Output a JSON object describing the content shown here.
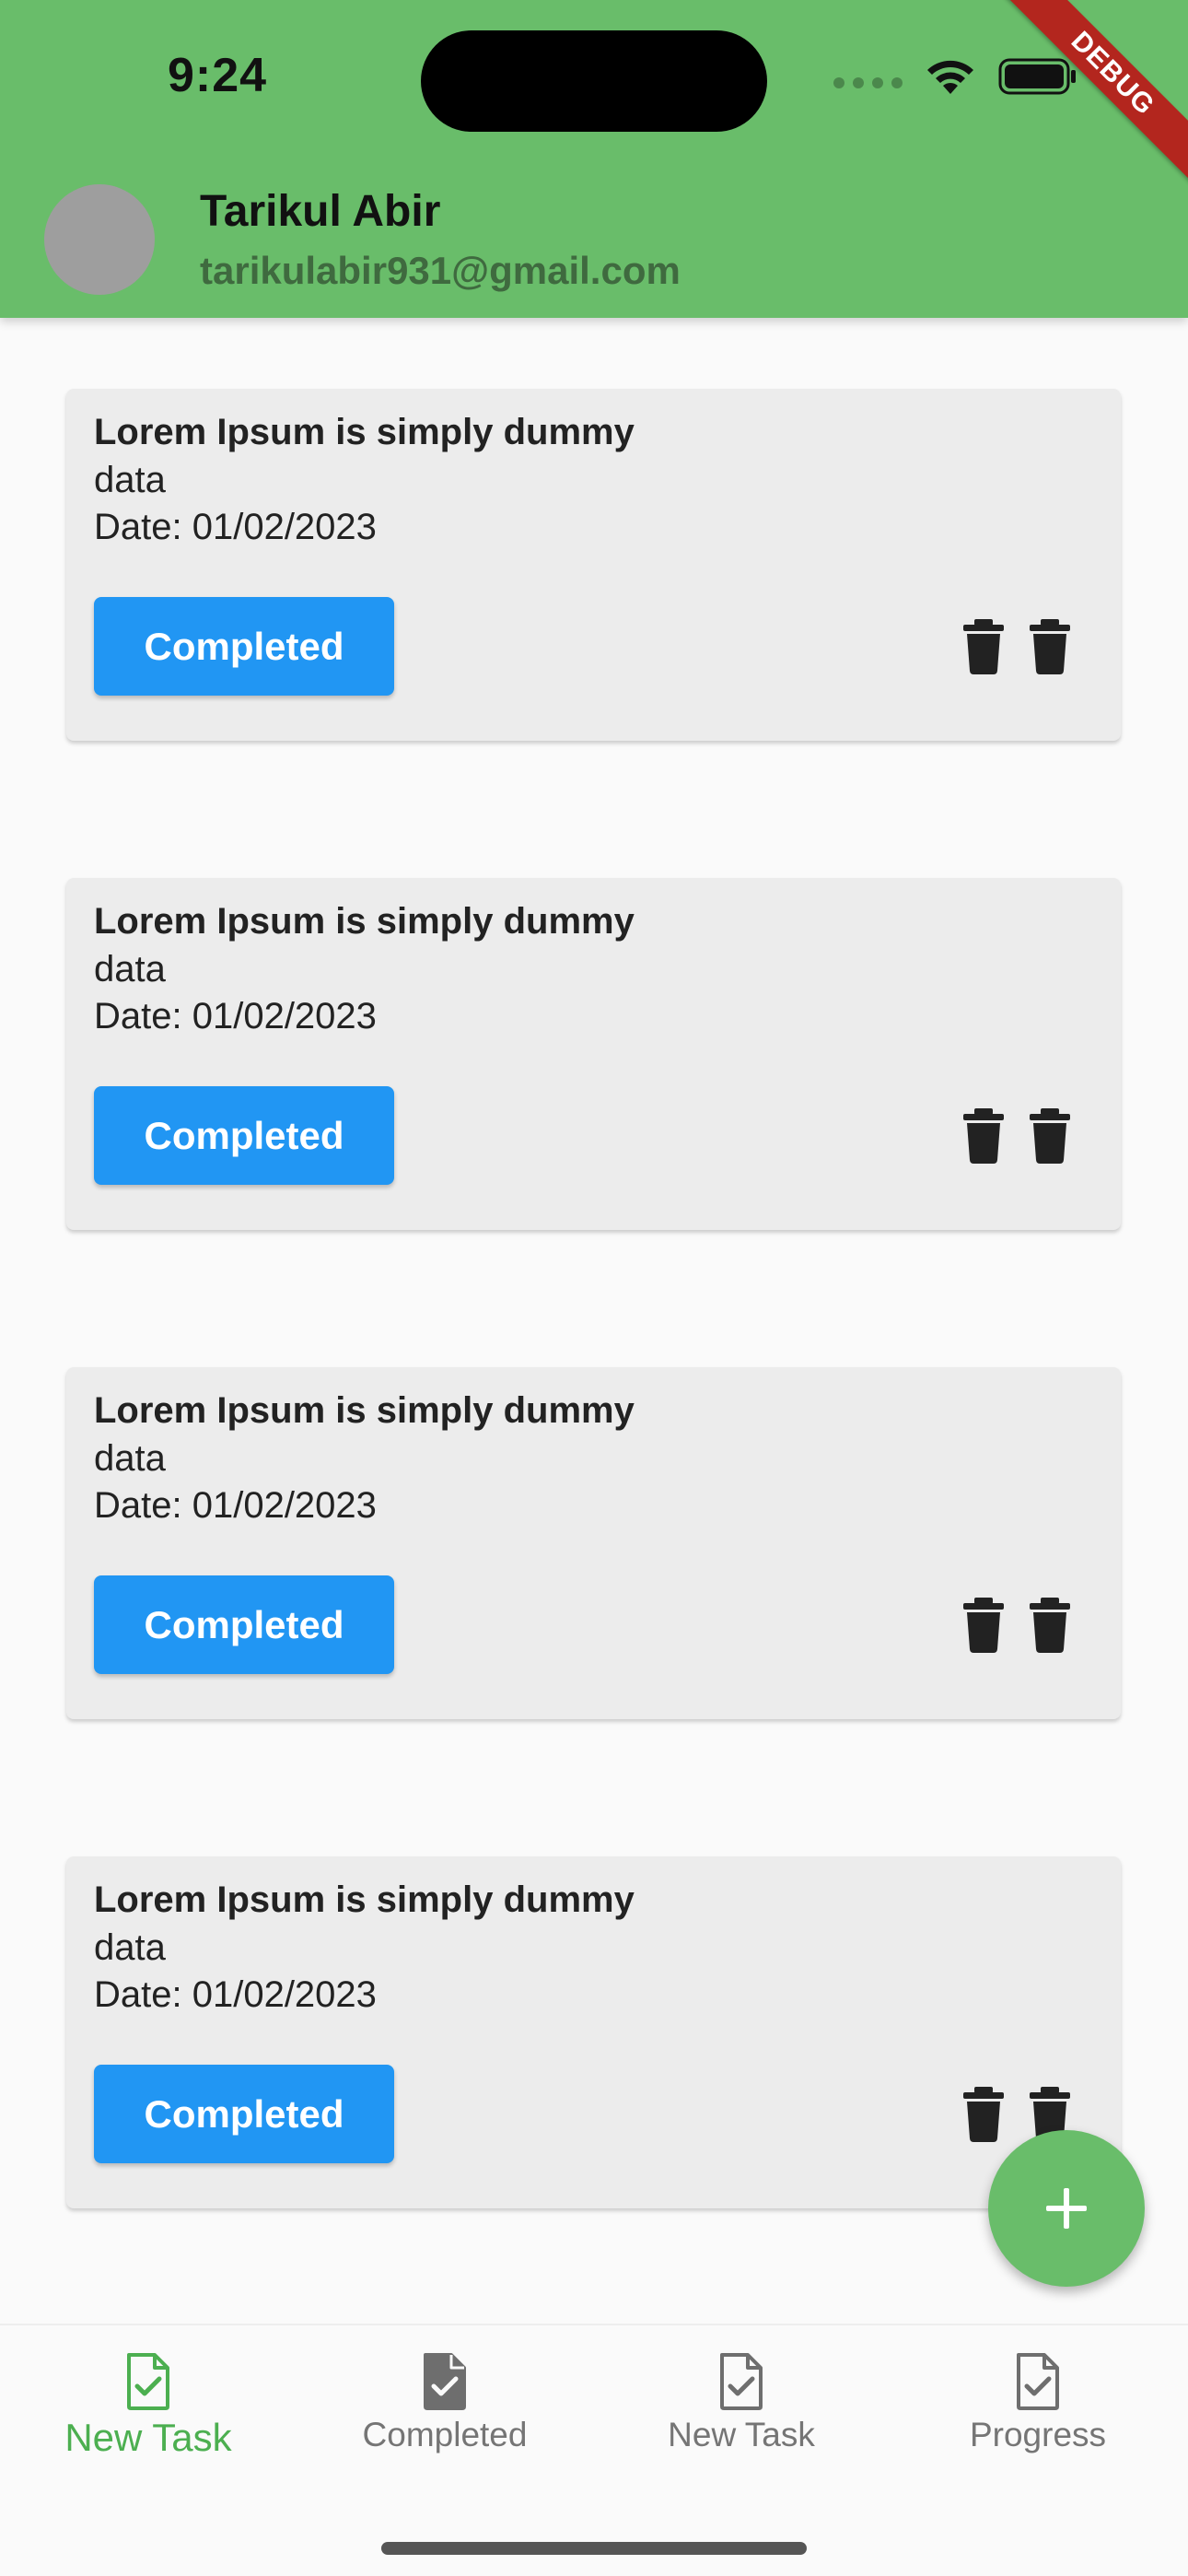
{
  "status_bar": {
    "time": "9:24",
    "debug_label": "DEBUG"
  },
  "profile": {
    "name": "Tarikul Abir",
    "email": "tarikulabir931@gmail.com"
  },
  "tasks": [
    {
      "title": "Lorem Ipsum is simply dummy",
      "description": "data",
      "date": "Date: 01/02/2023",
      "status": "Completed"
    },
    {
      "title": "Lorem Ipsum is simply dummy",
      "description": "data",
      "date": "Date: 01/02/2023",
      "status": "Completed"
    },
    {
      "title": "Lorem Ipsum is simply dummy",
      "description": "data",
      "date": "Date: 01/02/2023",
      "status": "Completed"
    },
    {
      "title": "Lorem Ipsum is simply dummy",
      "description": "data",
      "date": "Date: 01/02/2023",
      "status": "Completed"
    }
  ],
  "bottom_nav": {
    "items": [
      {
        "label": "New Task",
        "icon": "task-check-icon",
        "active": true
      },
      {
        "label": "Completed",
        "icon": "task-check-filled-icon",
        "active": false
      },
      {
        "label": "New Task",
        "icon": "task-check-icon",
        "active": false
      },
      {
        "label": "Progress",
        "icon": "task-check-icon",
        "active": false
      }
    ]
  },
  "fab": {
    "icon": "plus-icon"
  },
  "colors": {
    "header": "#69bd6a",
    "chip": "#2196f3",
    "active_nav": "#4caf50",
    "inactive_nav": "#757575"
  }
}
